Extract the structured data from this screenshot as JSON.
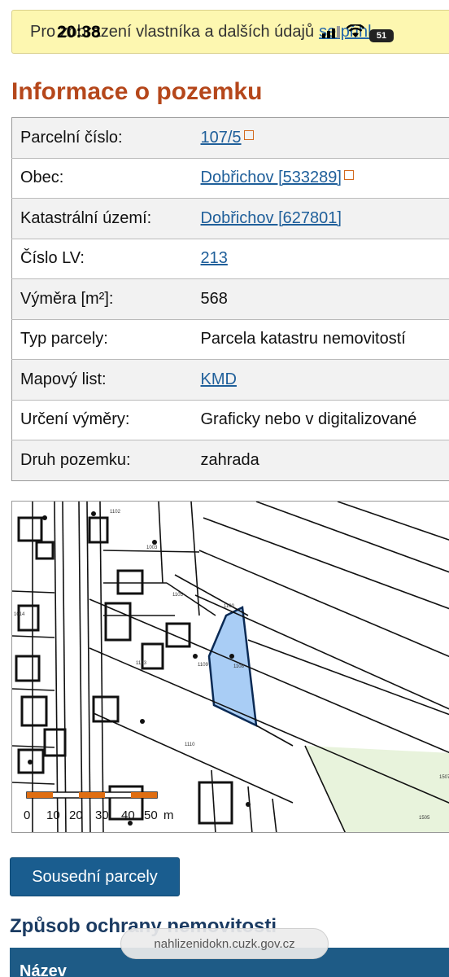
{
  "banner": {
    "text": "Pro zobrazení vlastníka a dalších údajů",
    "link": "se přihl"
  },
  "status_bar": {
    "time": "20:38",
    "battery": "51"
  },
  "section_title": "Informace o pozemku",
  "info_rows": [
    {
      "label": "Parcelní číslo:",
      "value": "107/5",
      "link": true,
      "external": true
    },
    {
      "label": "Obec:",
      "value": "Dobřichov [533289]",
      "link": true,
      "external": true
    },
    {
      "label": "Katastrální území:",
      "value": "Dobřichov [627801]",
      "link": true,
      "external": false
    },
    {
      "label": "Číslo LV:",
      "value": "213",
      "link": true,
      "external": false
    },
    {
      "label": "Výměra [m²]:",
      "value": "568",
      "link": false,
      "external": false
    },
    {
      "label": "Typ parcely:",
      "value": "Parcela katastru nemovitostí",
      "link": false,
      "external": false
    },
    {
      "label": "Mapový list:",
      "value": "KMD",
      "link": true,
      "external": false
    },
    {
      "label": "Určení výměry:",
      "value": "Graficky nebo v digitalizované",
      "link": false,
      "external": false
    },
    {
      "label": "Druh pozemku:",
      "value": "zahrada",
      "link": false,
      "external": false
    }
  ],
  "map": {
    "highlight_color": "#a9cdf5",
    "scale_labels": [
      "0",
      "10",
      "20",
      "30",
      "40",
      "50",
      "m"
    ]
  },
  "neighbors_button": "Sousední parcely",
  "protection_title": "Způsob ochrany nemovitosti",
  "url": "nahlizenidokn.cuzk.gov.cz",
  "table_header": "Název"
}
